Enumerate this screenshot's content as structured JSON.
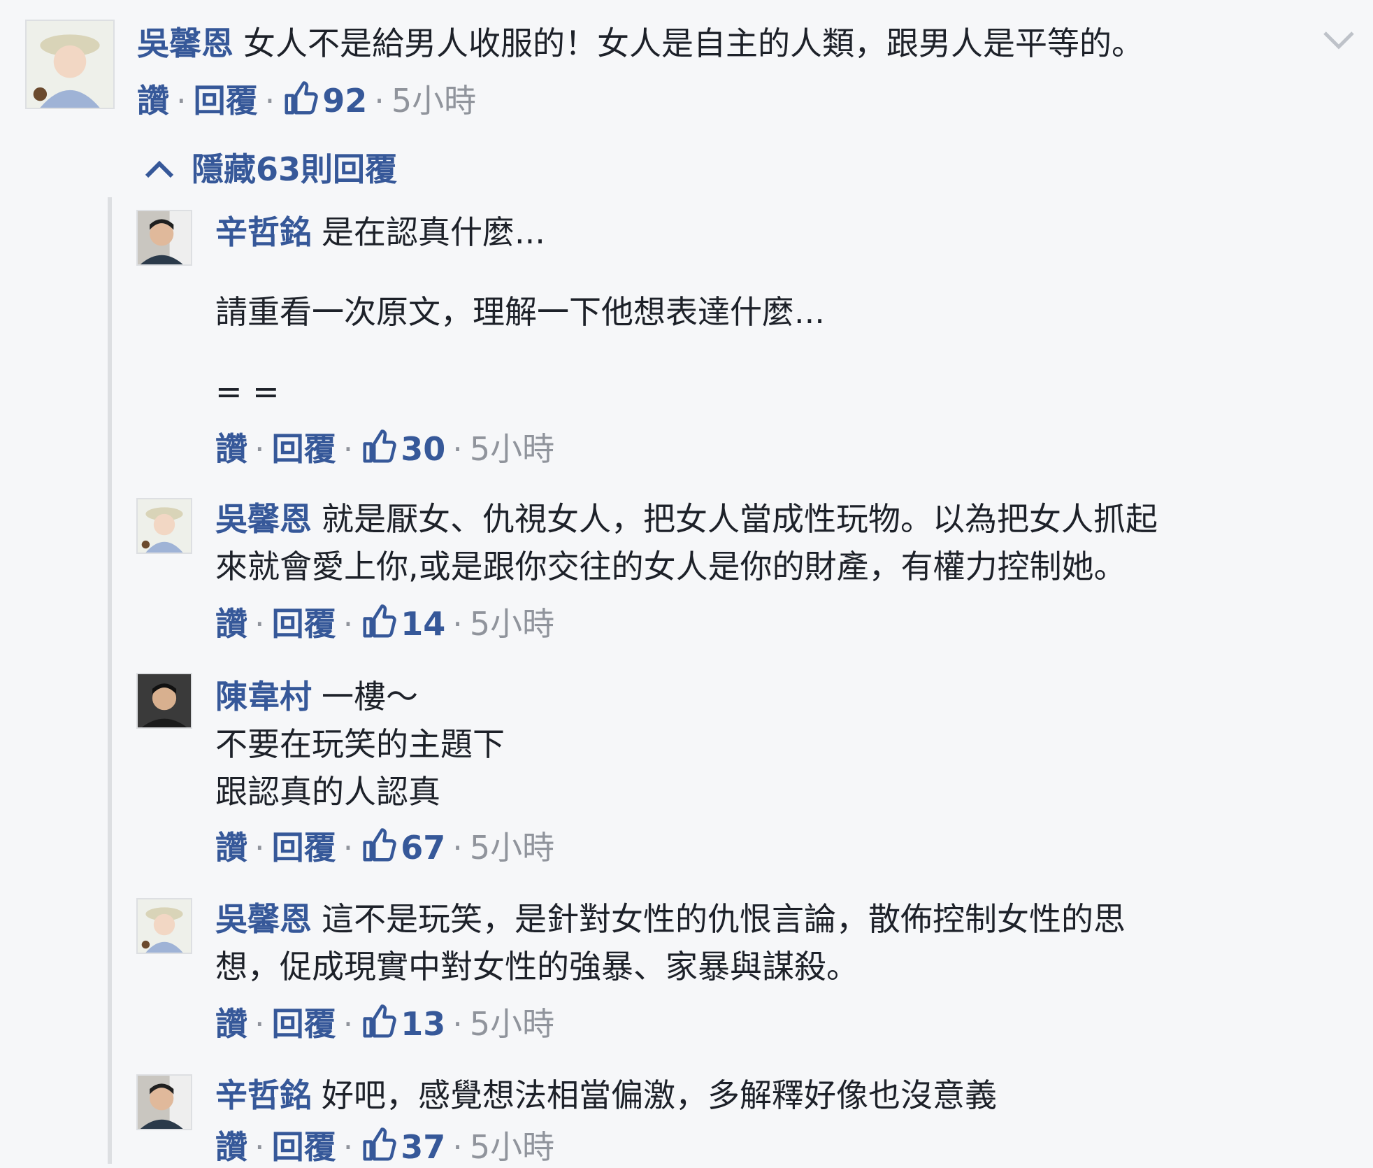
{
  "colors": {
    "link": "#365899",
    "meta": "#90949c",
    "text": "#1d2129",
    "background": "#f6f7f9"
  },
  "actions": {
    "like": "讚",
    "reply": "回覆",
    "sep": "·"
  },
  "top_comment": {
    "author": "吳馨恩",
    "text": "女人不是給男人收服的！女人是自主的人類，跟男人是平等的。",
    "likes": "92",
    "time": "5小時",
    "menu_icon": "chevron-down-icon"
  },
  "hide_replies": {
    "label": "隱藏63則回覆",
    "icon": "chevron-up-icon"
  },
  "replies": [
    {
      "author": "辛哲銘",
      "lines": [
        "是在認真什麼...",
        "",
        "請重看一次原文，理解一下他想表達什麼...",
        "",
        "= ="
      ],
      "likes": "30",
      "time": "5小時"
    },
    {
      "author": "吳馨恩",
      "lines": [
        "就是厭女、仇視女人，把女人當成性玩物。以為把女人抓起",
        "來就會愛上你,或是跟你交往的女人是你的財產，有權力控制她。"
      ],
      "likes": "14",
      "time": "5小時"
    },
    {
      "author": "陳韋村",
      "lines": [
        "一樓～",
        "不要在玩笑的主題下",
        "跟認真的人認真"
      ],
      "likes": "67",
      "time": "5小時"
    },
    {
      "author": "吳馨恩",
      "lines": [
        "這不是玩笑，是針對女性的仇恨言論，散佈控制女性的思",
        "想，促成現實中對女性的強暴、家暴與謀殺。"
      ],
      "likes": "13",
      "time": "5小時"
    },
    {
      "author": "辛哲銘",
      "lines": [
        "好吧，感覺想法相當偏激，多解釋好像也沒意義"
      ],
      "likes": "37",
      "time": "5小時"
    }
  ]
}
